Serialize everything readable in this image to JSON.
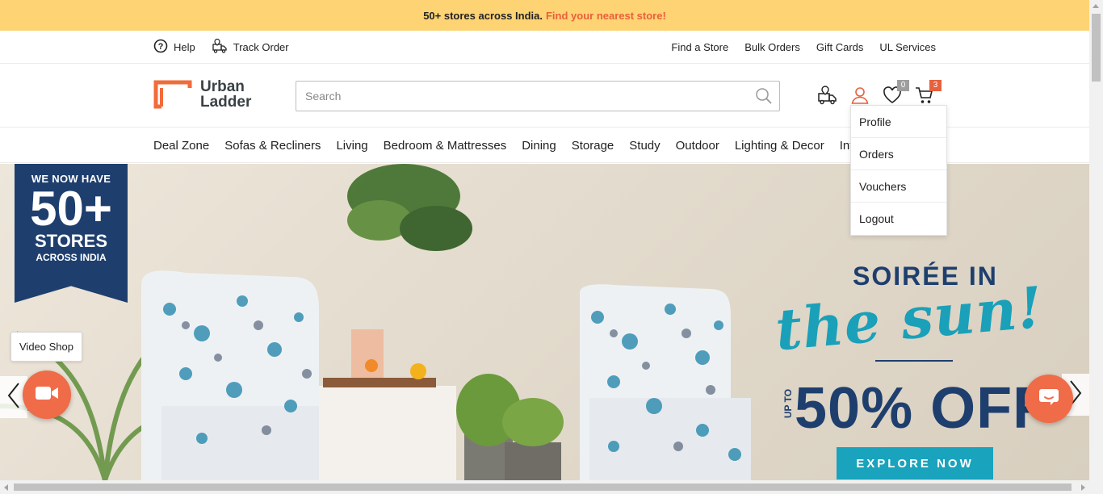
{
  "announcement": {
    "text": "50+ stores across India.",
    "link": "Find your nearest store!"
  },
  "utility_bar": {
    "help": "Help",
    "track_order": "Track Order",
    "right_links": [
      "Find a Store",
      "Bulk Orders",
      "Gift Cards",
      "UL Services"
    ]
  },
  "header": {
    "logo_line1": "Urban",
    "logo_line2": "Ladder",
    "search_placeholder": "Search",
    "wishlist_count": "0",
    "cart_count": "3"
  },
  "nav": {
    "items": [
      "Deal Zone",
      "Sofas & Recliners",
      "Living",
      "Bedroom & Mattresses",
      "Dining",
      "Storage",
      "Study",
      "Outdoor",
      "Lighting & Decor",
      "Inte"
    ]
  },
  "account_menu": {
    "items": [
      "Profile",
      "Orders",
      "Vouchers",
      "Logout"
    ]
  },
  "hero": {
    "ribbon_line1": "WE NOW HAVE",
    "ribbon_line2": "50+",
    "ribbon_line3": "STORES",
    "ribbon_line4": "ACROSS INDIA",
    "promo_line1": "SOIRÉE IN",
    "promo_script": "the sun!",
    "promo_upto": "UP TO",
    "promo_discount": "50% OFF",
    "cta": "EXPLORE NOW"
  },
  "floating": {
    "video_shop_label": "Video Shop"
  },
  "colors": {
    "announcement_bg": "#fdd373",
    "accent_orange": "#e8603c",
    "brand_navy": "#1e3f6e",
    "teal": "#19a3bd"
  }
}
